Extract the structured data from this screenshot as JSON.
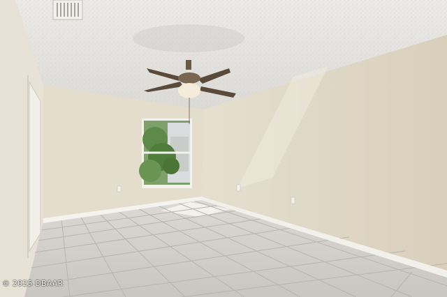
{
  "watermark": "© 2025 DBAAR",
  "colors": {
    "ceiling": "#e6e4e0",
    "left_wall": "#e6e0d2",
    "back_wall": "#e4ddcc",
    "right_wall": "#ded6c3",
    "floor": "#cfccc7",
    "baseboard": "#f4f2ee",
    "grout": "#b6b2ac"
  },
  "icons": [
    "ceiling-fan-icon",
    "air-vent-icon",
    "electrical-outlet-icon"
  ]
}
